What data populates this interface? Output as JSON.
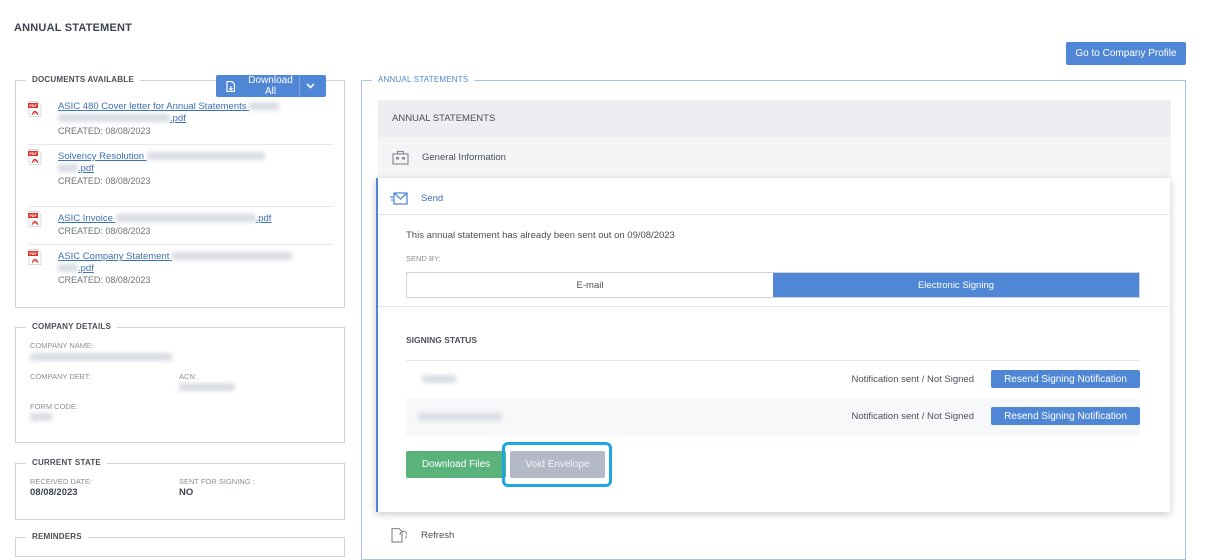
{
  "page": {
    "title": "ANNUAL STATEMENT"
  },
  "header": {
    "company_profile_button": "Go to Company Profile"
  },
  "documents": {
    "legend": "DOCUMENTS AVAILABLE",
    "download_all": "Download All",
    "items": [
      {
        "name": "ASIC 480 Cover letter for Annual Statements",
        "suffix": ".pdf",
        "created": "CREATED: 08/08/2023"
      },
      {
        "name": "Solvency Resolution",
        "suffix": ".pdf",
        "created": "CREATED: 08/08/2023"
      },
      {
        "name": "ASIC Invoice",
        "suffix": ".pdf",
        "created": "CREATED: 08/08/2023"
      },
      {
        "name": "ASIC Company Statement",
        "suffix": ".pdf",
        "created": "CREATED: 08/08/2023"
      }
    ]
  },
  "company_details": {
    "legend": "COMPANY DETAILS",
    "company_name_label": "COMPANY NAME:",
    "company_debt_label": "COMPANY DEBT:",
    "acn_label": "ACN:",
    "form_code_label": "FORM CODE:"
  },
  "current_state": {
    "legend": "CURRENT STATE",
    "received_date_label": "RECEIVED DATE:",
    "received_date": "08/08/2023",
    "sent_for_signing_label": "SENT FOR SIGNING :",
    "sent_for_signing": "NO"
  },
  "reminders": {
    "legend": "REMINDERS"
  },
  "annual_statements": {
    "legend": "ANNUAL STATEMENTS",
    "header": "ANNUAL STATEMENTS",
    "general_information": "General Information",
    "send": "Send",
    "sent_message": "This annual statement has already been sent out on 09/08/2023",
    "send_by_label": "SEND BY:",
    "send_by_options": [
      "E-mail",
      "Electronic Signing"
    ],
    "signing_status_title": "SIGNING STATUS",
    "signers": [
      {
        "status": "Notification sent / Not Signed",
        "action": "Resend Signing Notification"
      },
      {
        "status": "Notification sent / Not Signed",
        "action": "Resend Signing Notification"
      }
    ],
    "download_files": "Download Files",
    "void_envelope": "Void Envelope",
    "refresh": "Refresh"
  },
  "colors": {
    "accent": "#4f87d6",
    "green": "#5bb37c",
    "highlight": "#1ea7e4"
  }
}
